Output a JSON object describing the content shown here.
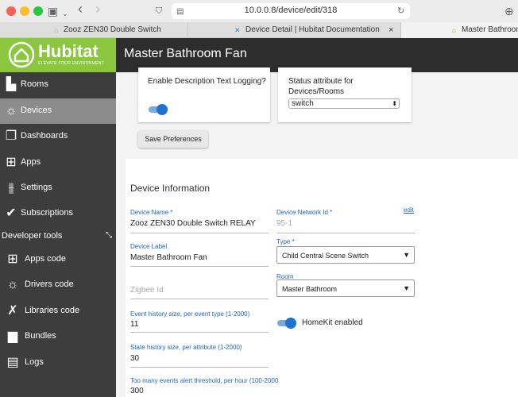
{
  "browser": {
    "url": "10.0.0.8/device/edit/318",
    "tabs": [
      {
        "title": "Zooz ZEN30 Double Switch"
      },
      {
        "title": "Device Detail | Hubitat Documentation"
      },
      {
        "title": "Master Bathroom Fan"
      }
    ]
  },
  "logo": {
    "title": "Hubitat",
    "subtitle": "ELEVATE YOUR ENVIRONMENT"
  },
  "sidebar": {
    "items": [
      {
        "label": "Rooms",
        "icon": "sofa-icon"
      },
      {
        "label": "Devices",
        "icon": "lightbulb-icon",
        "active": true
      },
      {
        "label": "Dashboards",
        "icon": "dashboards-icon"
      },
      {
        "label": "Apps",
        "icon": "apps-grid-icon"
      },
      {
        "label": "Settings",
        "icon": "sliders-icon"
      },
      {
        "label": "Subscriptions",
        "icon": "check-circle-icon"
      }
    ],
    "developer_tools": "Developer tools",
    "dev_items": [
      {
        "label": "Apps code",
        "icon": "apps-grid-icon"
      },
      {
        "label": "Drivers code",
        "icon": "lightbulb-icon"
      },
      {
        "label": "Libraries code",
        "icon": "tools-icon"
      },
      {
        "label": "Bundles",
        "icon": "bundle-icon"
      },
      {
        "label": "Logs",
        "icon": "document-icon"
      }
    ]
  },
  "header": {
    "title": "Master Bathroom Fan"
  },
  "preferences": {
    "description_logging_label": "Enable Description Text Logging?",
    "description_logging_on": true,
    "status_attribute_label": "Status attribute for Devices/Rooms",
    "status_attribute_value": "switch",
    "save_button": "Save Preferences"
  },
  "device_info": {
    "title": "Device Information",
    "device_name_label": "Device Name *",
    "device_name_value": "Zooz ZEN30 Double Switch RELAY",
    "network_id_label": "Device Network Id *",
    "network_id_value": "95-1",
    "edit_link": "edit",
    "device_label_label": "Device Label",
    "device_label_value": "Master Bathroom Fan",
    "type_label": "Type *",
    "type_value": "Child Central Scene Switch",
    "zigbee_placeholder": "Zigbee Id",
    "room_label": "Room",
    "room_value": "Master Bathroom",
    "event_history_label": "Event history size, per event type (1-2000)",
    "event_history_value": "11",
    "homekit_label": "HomeKit enabled",
    "homekit_on": true,
    "state_history_label": "State history size, per attribute (1-2000)",
    "state_history_value": "30",
    "too_many_events_label": "Too many events alert threshold, per hour (100-2000",
    "too_many_events_value": "300"
  },
  "colors": {
    "brand_green": "#8bc63f",
    "sidebar_bg": "#3d3d3d",
    "header_bg": "#2d2d2d",
    "accent_blue": "#1e73d2"
  }
}
